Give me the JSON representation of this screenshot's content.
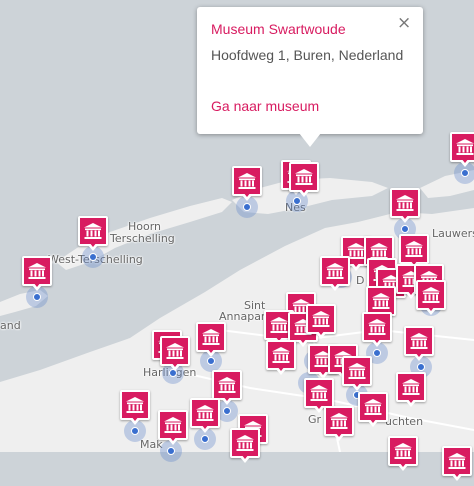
{
  "map": {
    "colors": {
      "water": "#cdd3d8",
      "land": "#efefef",
      "marker": "#d81b60",
      "location_dot": "#3a6fcf"
    },
    "place_labels": [
      "Hoorn",
      "Terschelling",
      "West-Terschelling",
      "Nes",
      "Lauwersoo",
      "Sint",
      "Annapar",
      "Harlingen",
      "Mak",
      "Gr",
      "uchten",
      "and",
      "D"
    ],
    "marker_icon": "museum-building-icon"
  },
  "popup": {
    "title": "Museum Swartwoude",
    "address": "Hoofdweg 1, Buren, Nederland",
    "link": "Ga naar museum",
    "close": "×"
  }
}
